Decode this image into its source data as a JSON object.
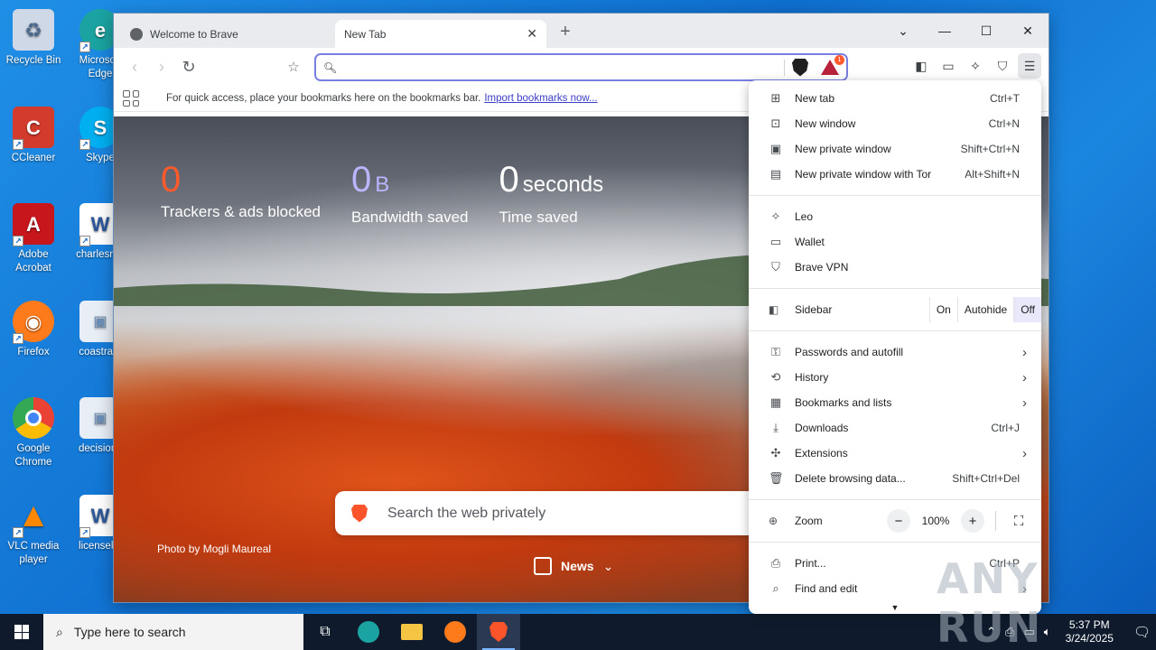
{
  "desktop": {
    "icons": [
      {
        "label": "Recycle Bin",
        "icon": "recycle-bin-icon",
        "color": "#cfd8e6"
      },
      {
        "label": "CCleaner",
        "icon": "ccleaner-icon",
        "color": "#d33c2c"
      },
      {
        "label": "Adobe Acrobat",
        "icon": "acrobat-icon",
        "color": "#c8161d"
      },
      {
        "label": "Firefox",
        "icon": "firefox-icon",
        "color": "#ff7a1a"
      },
      {
        "label": "Google Chrome",
        "icon": "chrome-icon",
        "color": "#34a853"
      },
      {
        "label": "VLC media player",
        "icon": "vlc-icon",
        "color": "#ff8800"
      },
      {
        "label": "Microsoft Edge",
        "icon": "edge-icon",
        "color": "#1aa3a1"
      },
      {
        "label": "Skype",
        "icon": "skype-icon",
        "color": "#00aff0"
      },
      {
        "label": "charlesran",
        "icon": "word-doc-icon",
        "color": "#2b579a"
      },
      {
        "label": "coastrath",
        "icon": "image-file-icon",
        "color": "#e8eef6"
      },
      {
        "label": "decisions",
        "icon": "image-file-icon",
        "color": "#e8eef6"
      },
      {
        "label": "licenseke",
        "icon": "word-doc-icon",
        "color": "#2b579a"
      }
    ]
  },
  "browser": {
    "tabs": [
      {
        "title": "Welcome to Brave"
      },
      {
        "title": "New Tab"
      }
    ],
    "omnibox": {
      "value": "",
      "placeholder": ""
    },
    "rewards_badge": "1",
    "bookmarks_bar": {
      "message": "For quick access, place your bookmarks here on the bookmarks bar.",
      "link": "Import bookmarks now..."
    },
    "ntp": {
      "stats": [
        {
          "value": "0",
          "unit": "",
          "label": "Trackers & ads blocked"
        },
        {
          "value": "0",
          "unit": "B",
          "label": "Bandwidth saved"
        },
        {
          "value": "0",
          "unit": "seconds",
          "label": "Time saved"
        }
      ],
      "search_placeholder": "Search the web privately",
      "photo_credit": "Photo by Mogli Maureal",
      "news_label": "News"
    }
  },
  "menu": {
    "group1": [
      {
        "label": "New tab",
        "shortcut": "Ctrl+T",
        "icon": "plus-square-icon"
      },
      {
        "label": "New window",
        "shortcut": "Ctrl+N",
        "icon": "window-icon"
      },
      {
        "label": "New private window",
        "shortcut": "Shift+Ctrl+N",
        "icon": "private-window-icon"
      },
      {
        "label": "New private window with Tor",
        "shortcut": "Alt+Shift+N",
        "icon": "tor-window-icon"
      }
    ],
    "group2": [
      {
        "label": "Leo",
        "icon": "leo-icon"
      },
      {
        "label": "Wallet",
        "icon": "wallet-icon"
      },
      {
        "label": "Brave VPN",
        "icon": "vpn-shield-icon"
      }
    ],
    "sidebar": {
      "label": "Sidebar",
      "options": [
        "On",
        "Autohide",
        "Off"
      ],
      "selected": "Off"
    },
    "group3": [
      {
        "label": "Passwords and autofill",
        "shortcut": "",
        "arrow": true,
        "icon": "key-icon"
      },
      {
        "label": "History",
        "shortcut": "",
        "arrow": true,
        "icon": "history-icon"
      },
      {
        "label": "Bookmarks and lists",
        "shortcut": "",
        "arrow": true,
        "icon": "bookmarks-icon"
      },
      {
        "label": "Downloads",
        "shortcut": "Ctrl+J",
        "arrow": false,
        "icon": "download-icon"
      },
      {
        "label": "Extensions",
        "shortcut": "",
        "arrow": true,
        "icon": "puzzle-icon"
      },
      {
        "label": "Delete browsing data...",
        "shortcut": "Shift+Ctrl+Del",
        "arrow": false,
        "icon": "trash-icon"
      }
    ],
    "zoom": {
      "label": "Zoom",
      "value": "100%"
    },
    "group4": [
      {
        "label": "Print...",
        "shortcut": "Ctrl+P",
        "arrow": false,
        "icon": "print-icon"
      },
      {
        "label": "Find and edit",
        "shortcut": "",
        "arrow": true,
        "icon": "find-icon"
      }
    ]
  },
  "watermark": "ANY RUN",
  "taskbar": {
    "search_placeholder": "Type here to search",
    "time": "5:37 PM",
    "date": "3/24/2025"
  }
}
